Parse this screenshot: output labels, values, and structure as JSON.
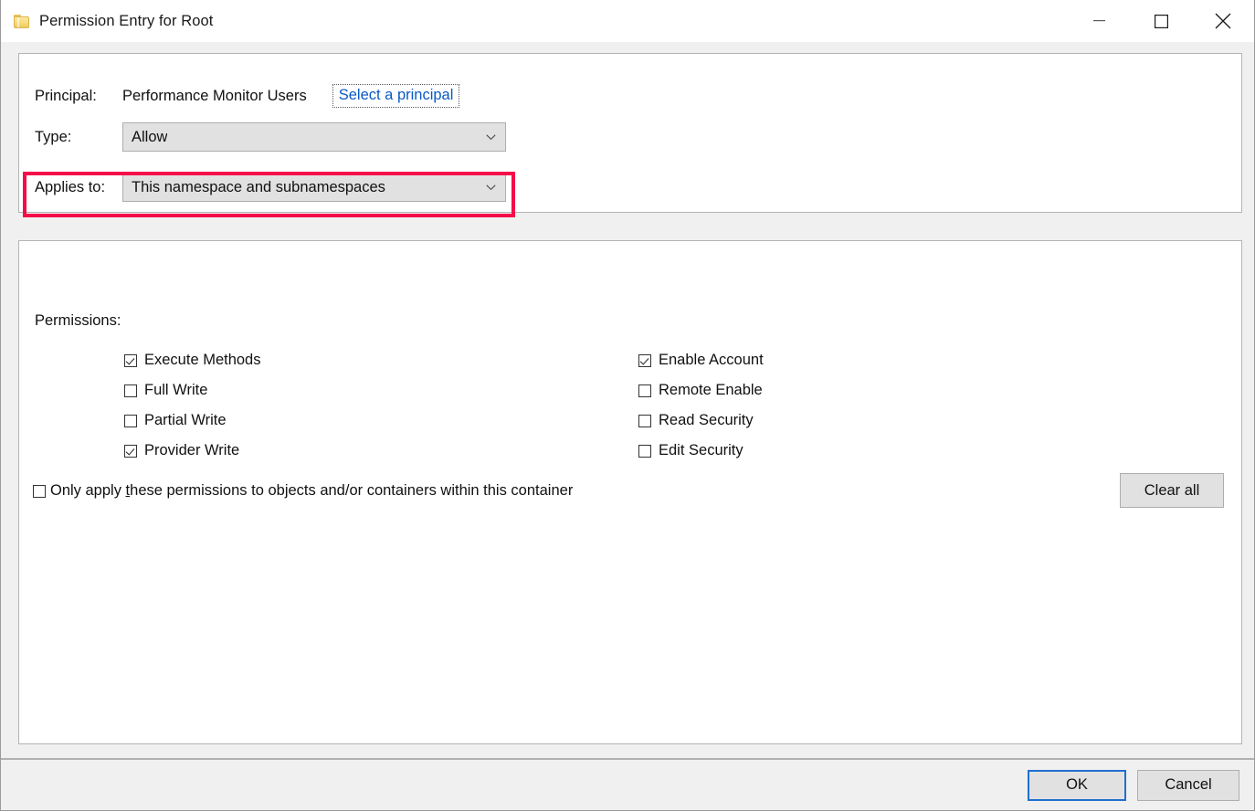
{
  "window": {
    "title": "Permission Entry for Root",
    "icon": "folder-icon",
    "caption": {
      "minimize_label": "Minimize",
      "maximize_label": "Maximize",
      "close_label": "Close"
    }
  },
  "top_panel": {
    "principal": {
      "label": "Principal:",
      "value": "Performance Monitor Users",
      "link_label": "Select a principal"
    },
    "type": {
      "label": "Type:",
      "value": "Allow",
      "arrow_icon": "chevron-down-icon"
    },
    "applies_to": {
      "label": "Applies to:",
      "value": "This namespace and subnamespaces",
      "arrow_icon": "chevron-down-icon",
      "highlight_color": "#f50a4a",
      "highlighted": true
    }
  },
  "permissions_panel": {
    "title": "Permissions:",
    "left_column": [
      {
        "label": "Execute Methods",
        "checked": true
      },
      {
        "label": "Full Write",
        "checked": false
      },
      {
        "label": "Partial Write",
        "checked": false
      },
      {
        "label": "Provider Write",
        "checked": true
      }
    ],
    "right_column": [
      {
        "label": "Enable Account",
        "checked": true
      },
      {
        "label": "Remote Enable",
        "checked": false
      },
      {
        "label": "Read Security",
        "checked": false
      },
      {
        "label": "Edit Security",
        "checked": false
      }
    ],
    "only_apply": {
      "text_before": "Only apply ",
      "accel": "t",
      "text_after": "hese permissions to objects and/or containers within this container",
      "checked": false
    },
    "clear_all_label": "Clear all"
  },
  "footer": {
    "ok_label": "OK",
    "cancel_label": "Cancel"
  },
  "colors": {
    "window_background": "#f0f0f0",
    "panel_background": "#ffffff",
    "panel_border": "#b4b4b4",
    "control_background": "#e1e1e1",
    "control_border": "#adadad",
    "link": "#0a5ac4",
    "highlight": "#f50a4a",
    "focus_border": "#1f6fce",
    "text": "#111111"
  }
}
